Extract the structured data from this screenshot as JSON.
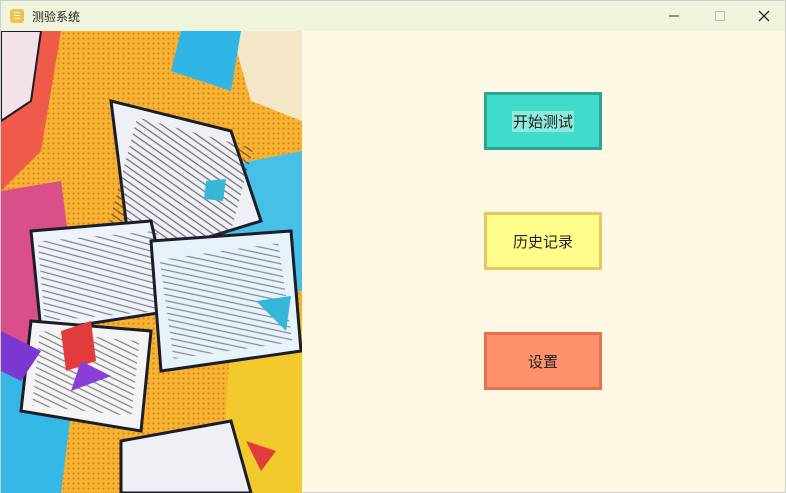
{
  "window": {
    "title": "测验系统",
    "controls": [
      "minimize-icon",
      "maximize-icon",
      "close-icon"
    ]
  },
  "side_image": {
    "description_icon": "comic-papers-illustration"
  },
  "menu": {
    "start_test": "开始测试",
    "history": "历史记录",
    "settings": "设置"
  },
  "colors": {
    "background": "#fff8e4",
    "titlebar": "#eef5dc",
    "start_button": "#40dccb",
    "history_button": "#fffe8a",
    "settings_button": "#fe926c"
  }
}
